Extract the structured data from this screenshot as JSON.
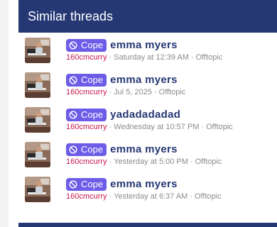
{
  "widget": {
    "title": "Similar threads"
  },
  "colors": {
    "header_bg": "#253874",
    "prefix_bg": "#6d5ce8",
    "username": "#c8174a",
    "title": "#253874"
  },
  "threads": [
    {
      "prefix_icon": "ban-icon",
      "prefix": "Cope",
      "title": "emma myers",
      "author": "160cmcurry",
      "time": "Saturday at 12:39 AM",
      "forum": "Offtopic"
    },
    {
      "prefix_icon": "ban-icon",
      "prefix": "Cope",
      "title": "emma myers",
      "author": "160cmcurry",
      "time": "Jul 5, 2025",
      "forum": "Offtopic"
    },
    {
      "prefix_icon": "ban-icon",
      "prefix": "Cope",
      "title": "yadadadadad",
      "author": "160cmcurry",
      "time": "Wednesday at 10:57 PM",
      "forum": "Offtopic"
    },
    {
      "prefix_icon": "ban-icon",
      "prefix": "Cope",
      "title": "emma myers",
      "author": "160cmcurry",
      "time": "Yesterday at 5:00 PM",
      "forum": "Offtopic"
    },
    {
      "prefix_icon": "ban-icon",
      "prefix": "Cope",
      "title": "emma myers",
      "author": "160cmcurry",
      "time": "Yesterday at 6:37 AM",
      "forum": "Offtopic"
    }
  ]
}
